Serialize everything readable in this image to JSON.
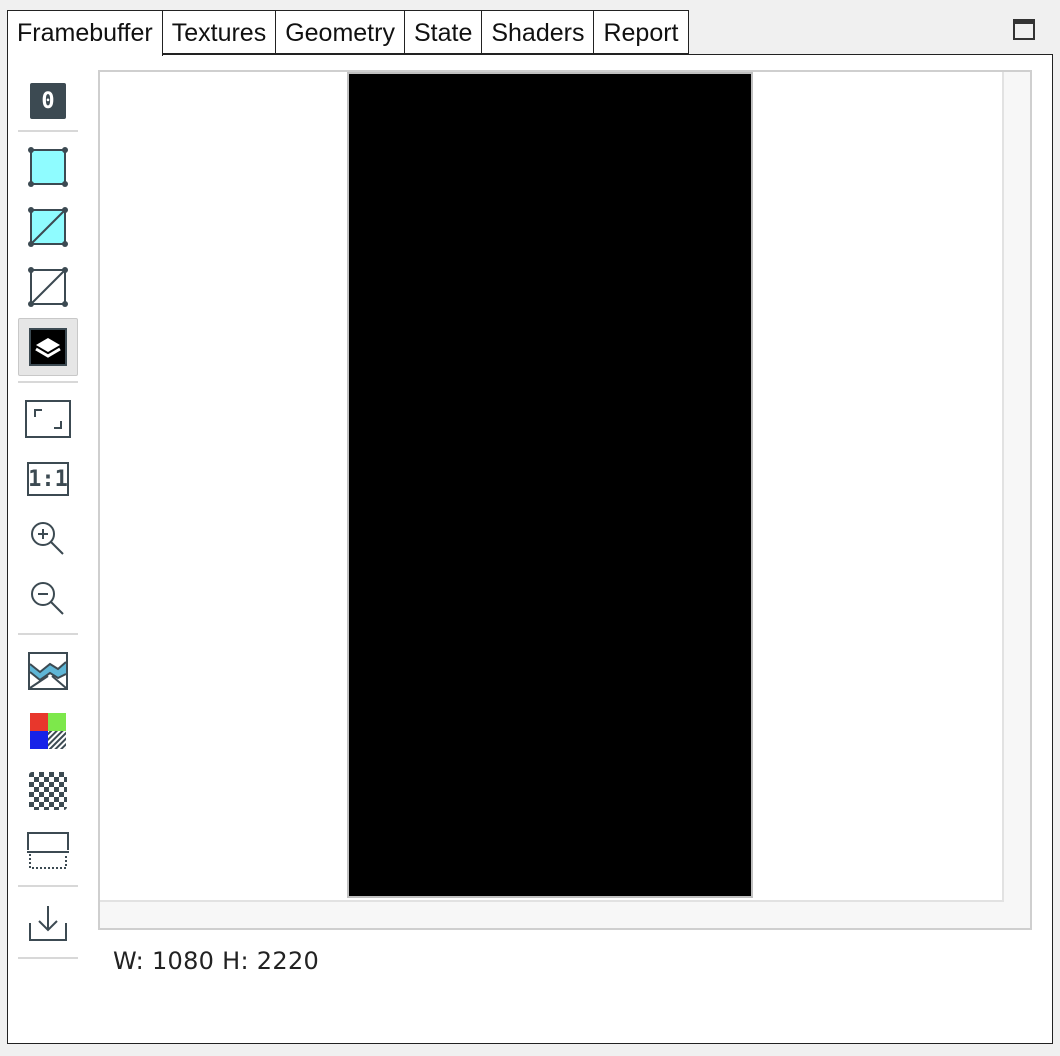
{
  "tabs": [
    {
      "label": "Framebuffer",
      "active": true
    },
    {
      "label": "Textures"
    },
    {
      "label": "Geometry"
    },
    {
      "label": "State"
    },
    {
      "label": "Shaders"
    },
    {
      "label": "Report"
    }
  ],
  "toolbar": {
    "attachment_index": "0",
    "zoom_actual_label": "1:1",
    "items": [
      "attachment-select",
      "wireframe-off-icon",
      "wireframe-fill-icon",
      "wireframe-only-icon",
      "overlay-icon",
      "fit-to-window-icon",
      "zoom-actual-icon",
      "zoom-in-icon",
      "zoom-out-icon",
      "histogram-icon",
      "color-channels-icon",
      "transparency-checkerboard-icon",
      "flip-vertical-icon",
      "save-download-icon"
    ]
  },
  "status": {
    "dimensions": "W: 1080 H: 2220"
  },
  "colors": {
    "framebuffer_fill": "#000000",
    "wireframe_fill": "#8ffcff",
    "icon_stroke": "#3c4a52"
  }
}
